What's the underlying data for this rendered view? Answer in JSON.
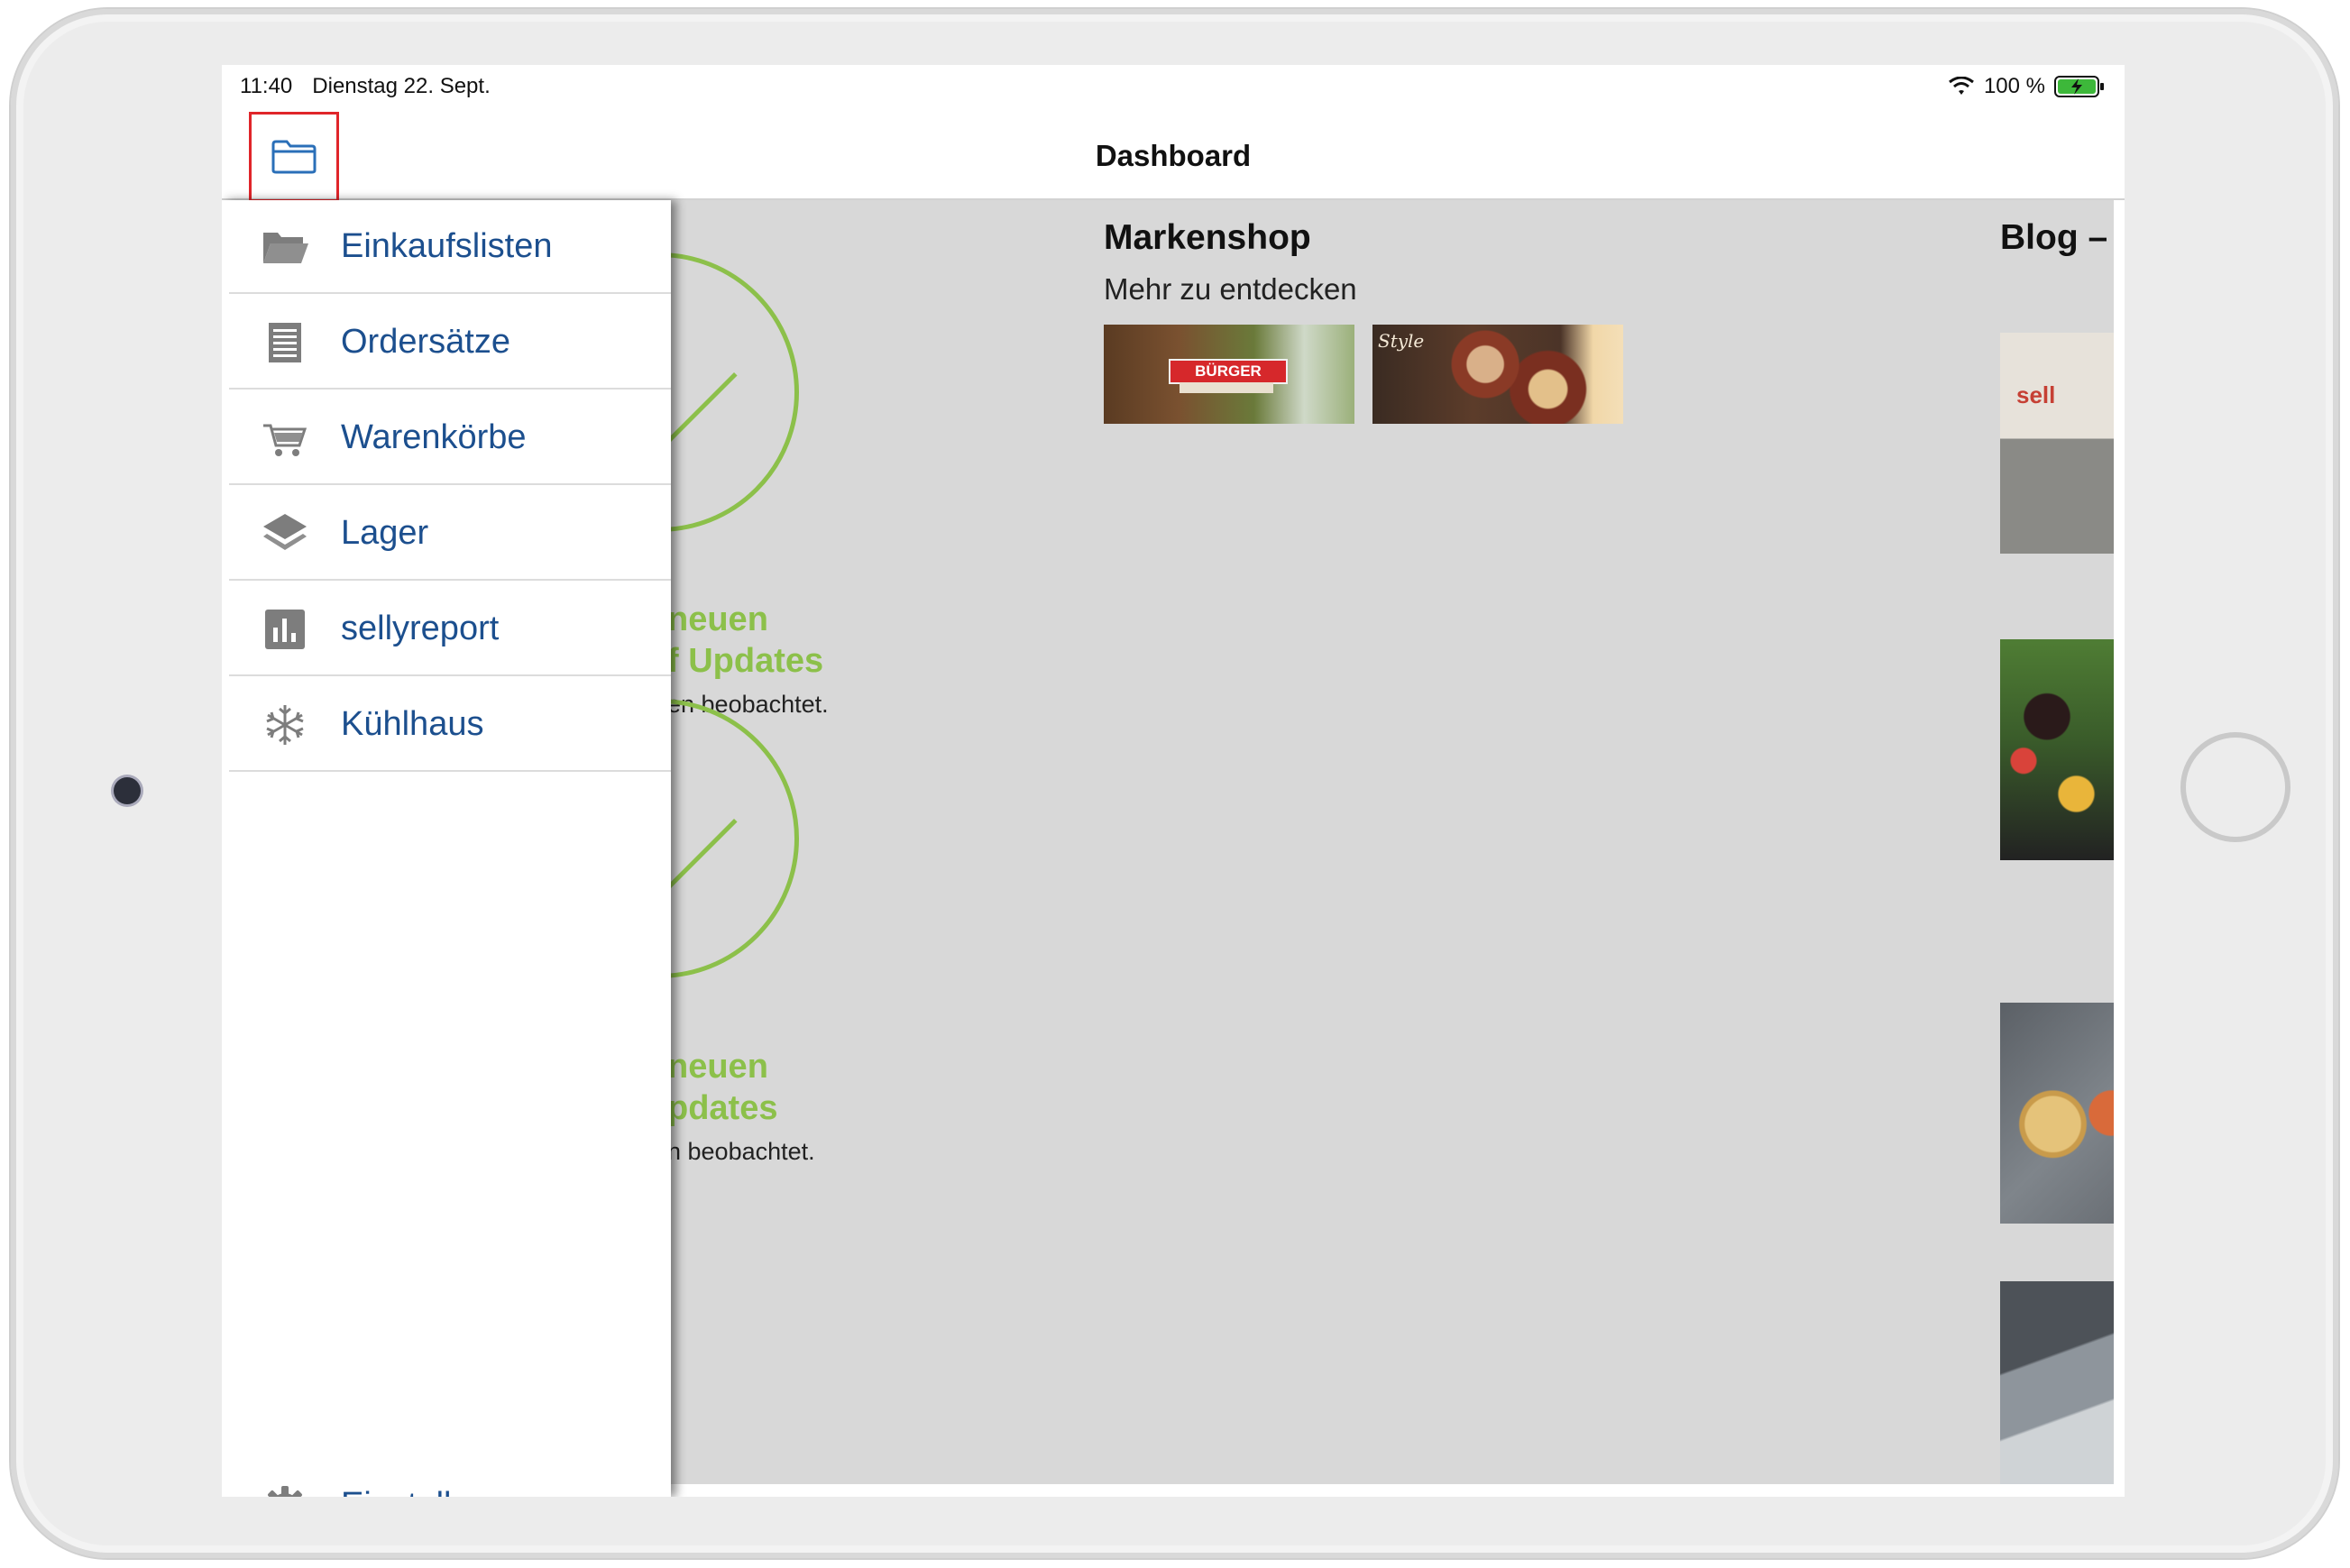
{
  "statusbar": {
    "time": "11:40",
    "date": "Dienstag 22. Sept.",
    "battery": "100 %"
  },
  "navbar": {
    "title": "Dashboard",
    "folder_icon": "folder-icon"
  },
  "drawer": {
    "items": [
      {
        "label": "Einkaufslisten",
        "icon": "open-folder-icon"
      },
      {
        "label": "Ordersätze",
        "icon": "document-list-icon"
      },
      {
        "label": "Warenkörbe",
        "icon": "shopping-cart-icon"
      },
      {
        "label": "Lager",
        "icon": "layers-icon"
      },
      {
        "label": "sellyreport",
        "icon": "bar-chart-icon"
      },
      {
        "label": "Kühlhaus",
        "icon": "snowflake-icon"
      }
    ],
    "settings": {
      "label": "Einstellungen",
      "icon": "gear-icon"
    }
  },
  "dashboard": {
    "widget1": {
      "line1": "neuen",
      "line2": "f Updates",
      "line3": "en beobachtet."
    },
    "widget2": {
      "line1": "neuen",
      "line2": "pdates",
      "line3": "n beobachtet."
    },
    "markenshop": {
      "title": "Markenshop",
      "subtitle": "Mehr zu entdecken",
      "tiles": [
        {
          "badge": "BÜRGER"
        },
        {
          "label": "Style"
        }
      ]
    },
    "blog": {
      "title": "Blog – s",
      "thumb1_mark": "sell"
    }
  },
  "colors": {
    "accent_blue": "#1c4f8e",
    "accent_green": "#8cc04a",
    "highlight_red": "#e0252a",
    "content_gray": "#d8d8d8"
  }
}
